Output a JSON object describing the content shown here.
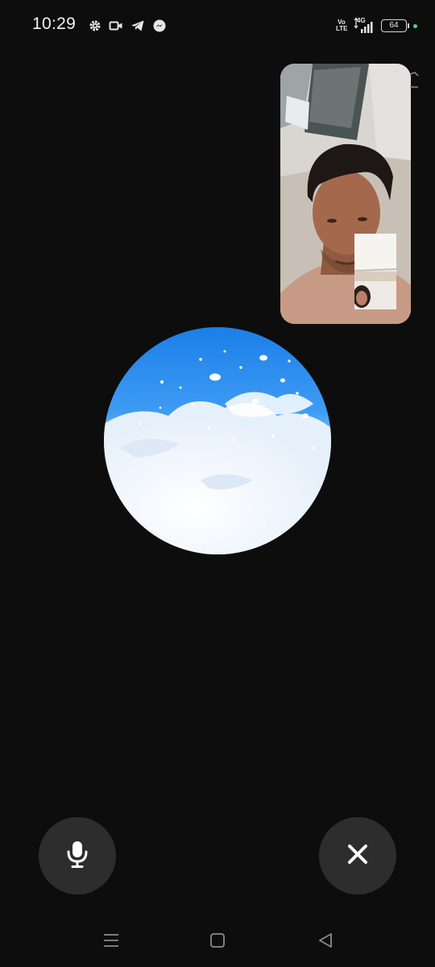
{
  "status_bar": {
    "time": "10:29",
    "icons": [
      "settings-gear-icon",
      "video-camera-icon",
      "telegram-icon",
      "messenger-icon"
    ],
    "volte_label": "Vo LTE",
    "network_label": "4G",
    "battery_level": "64"
  },
  "remote_video": {
    "frame_color": "#c9c1b8"
  },
  "avatar": {
    "colors": {
      "sky_top": "#1a7fe6",
      "sky_mid": "#4aa3f5",
      "cloud": "#f3f7fc"
    }
  },
  "controls": {
    "mic_icon": "microphone-icon",
    "end_icon": "close-x-icon",
    "button_color": "#2d2d2d"
  },
  "nav_bar": {
    "items": [
      "recents-icon",
      "home-icon",
      "back-icon"
    ]
  }
}
